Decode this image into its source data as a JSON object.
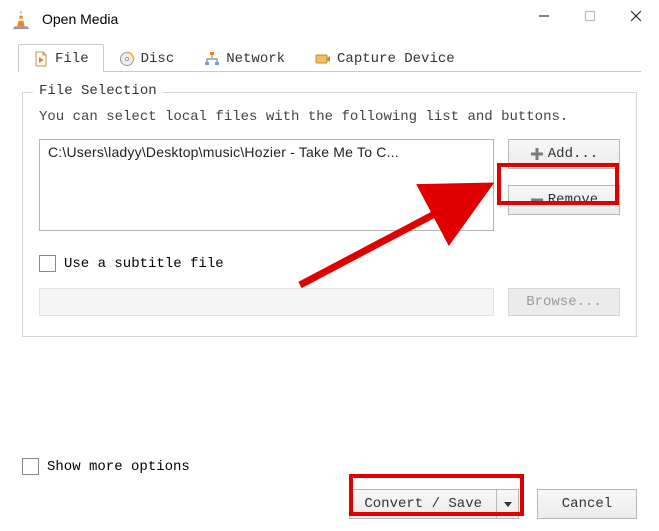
{
  "window": {
    "title": "Open Media"
  },
  "tabs": {
    "file": "File",
    "disc": "Disc",
    "network": "Network",
    "capture": "Capture Device"
  },
  "file_selection": {
    "legend": "File Selection",
    "help": "You can select local files with the following list and buttons.",
    "items": [
      "C:\\Users\\ladyy\\Desktop\\music\\Hozier - Take Me To C..."
    ],
    "add_label": "Add...",
    "remove_label": "Remove"
  },
  "subtitle": {
    "checkbox_label": "Use a subtitle file",
    "browse_label": "Browse..."
  },
  "footer": {
    "show_more": "Show more options",
    "convert_label": "Convert / Save",
    "cancel_label": "Cancel"
  }
}
